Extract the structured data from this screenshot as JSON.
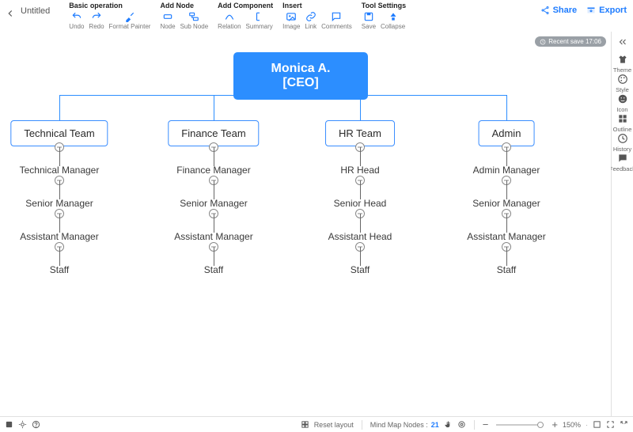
{
  "doc_title": "Untitled",
  "toolbar": {
    "groups": [
      {
        "title": "Basic operation",
        "items": [
          {
            "id": "undo",
            "label": "Undo",
            "icon": "undo"
          },
          {
            "id": "redo",
            "label": "Redo",
            "icon": "redo"
          },
          {
            "id": "format-painter",
            "label": "Format Painter",
            "icon": "brush"
          }
        ]
      },
      {
        "title": "Add Node",
        "items": [
          {
            "id": "node",
            "label": "Node",
            "icon": "node"
          },
          {
            "id": "sub-node",
            "label": "Sub Node",
            "icon": "subnode"
          }
        ]
      },
      {
        "title": "Add Component",
        "items": [
          {
            "id": "relation",
            "label": "Relation",
            "icon": "relation"
          },
          {
            "id": "summary",
            "label": "Summary",
            "icon": "summary"
          }
        ]
      },
      {
        "title": "Insert",
        "items": [
          {
            "id": "image",
            "label": "Image",
            "icon": "image"
          },
          {
            "id": "link",
            "label": "Link",
            "icon": "link"
          },
          {
            "id": "comments",
            "label": "Comments",
            "icon": "comments"
          }
        ]
      },
      {
        "title": "Tool Settings",
        "items": [
          {
            "id": "save",
            "label": "Save",
            "icon": "save"
          },
          {
            "id": "collapse",
            "label": "Collapse",
            "icon": "collapse"
          }
        ]
      }
    ],
    "share": "Share",
    "export": "Export"
  },
  "sidebar": {
    "items": [
      {
        "id": "theme",
        "label": "Theme",
        "icon": "shirt"
      },
      {
        "id": "style",
        "label": "Style",
        "icon": "palette"
      },
      {
        "id": "icon",
        "label": "Icon",
        "icon": "face"
      },
      {
        "id": "outline",
        "label": "Outline",
        "icon": "grid"
      },
      {
        "id": "history",
        "label": "History",
        "icon": "clock"
      },
      {
        "id": "feedback",
        "label": "Feedback",
        "icon": "chat"
      }
    ]
  },
  "save_badge": "Recent save 17:06",
  "bottombar": {
    "reset_layout": "Reset layout",
    "nodes_label": "Mind Map Nodes :",
    "nodes_count": "21",
    "zoom_percent": "150%"
  },
  "org": {
    "root": "Monica A. [CEO]",
    "teams": [
      {
        "name": "Technical Team",
        "chain": [
          "Technical Manager",
          "Senior Manager",
          "Assistant Manager",
          "Staff"
        ]
      },
      {
        "name": "Finance Team",
        "chain": [
          "Finance Manager",
          "Senior Manager",
          "Assistant Manager",
          "Staff"
        ]
      },
      {
        "name": "HR Team",
        "chain": [
          "HR Head",
          "Senior Head",
          "Assistant Head",
          "Staff"
        ]
      },
      {
        "name": "Admin",
        "chain": [
          "Admin Manager",
          "Senior Manager",
          "Assistant Manager",
          "Staff"
        ]
      }
    ]
  },
  "colors": {
    "accent": "#2c8eff",
    "line": "#2c8eff"
  }
}
